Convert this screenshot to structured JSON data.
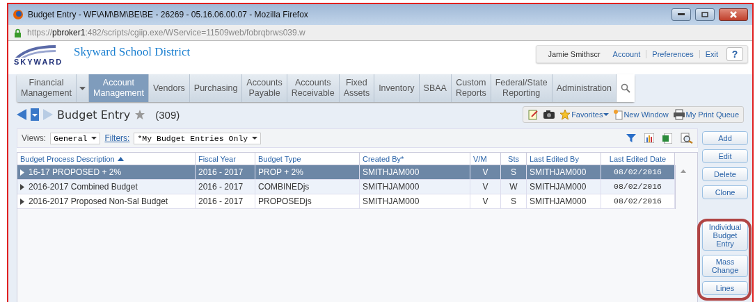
{
  "window": {
    "title": "Budget Entry - WF\\AM\\BM\\BE\\BE - 26269 - 05.16.06.00.07 - Mozilla Firefox",
    "url_prefix": "https://",
    "url_host": "pbroker1",
    "url_rest": ":482/scripts/cgiip.exe/WService=11509web/fobrqbrws039.w"
  },
  "header": {
    "logo_text": "SKYWARD",
    "district": "Skyward School District",
    "user": "Jamie Smithscr",
    "links": [
      "Account",
      "Preferences",
      "Exit"
    ],
    "help": "?"
  },
  "nav": [
    {
      "label": "Financial Management",
      "selected": false,
      "dropdown": true
    },
    {
      "label": "Account Management",
      "selected": true,
      "dropdown": false
    },
    {
      "label": "Vendors",
      "selected": false,
      "dropdown": false
    },
    {
      "label": "Purchasing",
      "selected": false,
      "dropdown": false
    },
    {
      "label": "Accounts Payable",
      "selected": false,
      "dropdown": false
    },
    {
      "label": "Accounts Receivable",
      "selected": false,
      "dropdown": false
    },
    {
      "label": "Fixed Assets",
      "selected": false,
      "dropdown": false
    },
    {
      "label": "Inventory",
      "selected": false,
      "dropdown": false
    },
    {
      "label": "SBAA",
      "selected": false,
      "dropdown": false
    },
    {
      "label": "Custom Reports",
      "selected": false,
      "dropdown": false
    },
    {
      "label": "Federal/State Reporting",
      "selected": false,
      "dropdown": false
    },
    {
      "label": "Administration",
      "selected": false,
      "dropdown": false
    }
  ],
  "page": {
    "title": "Budget Entry",
    "count": "(309)"
  },
  "tools": [
    {
      "kind": "notes"
    },
    {
      "kind": "camera"
    },
    {
      "kind": "star",
      "label": "Favorites"
    },
    {
      "kind": "window",
      "label": "New Window"
    },
    {
      "kind": "printer",
      "label": "My Print Queue"
    }
  ],
  "views": {
    "label": "Views:",
    "value": "General",
    "filters_label": "Filters:",
    "filter_value": "*My Budget Entries Only"
  },
  "table": {
    "columns": [
      {
        "label": "Budget Process Description",
        "sorted": true
      },
      {
        "label": "Fiscal Year",
        "sorted": false
      },
      {
        "label": "Budget Type",
        "sorted": false
      },
      {
        "label": "Created By*",
        "sorted": false
      },
      {
        "label": "V/M",
        "sorted": false
      },
      {
        "label": "Sts",
        "sorted": false
      },
      {
        "label": "Last Edited By",
        "sorted": false
      },
      {
        "label": "Last Edited Date",
        "sorted": false
      }
    ],
    "rows": [
      {
        "selected": true,
        "cells": [
          "16-17 PROPOSED + 2%",
          "2016 - 2017",
          "PROP + 2%",
          "SMITHJAM000",
          "V",
          "S",
          "SMITHJAM000",
          "08/02/2016"
        ]
      },
      {
        "selected": false,
        "cells": [
          "2016-2017 Combined Budget",
          "2016 - 2017",
          "COMBINEDjs",
          "SMITHJAM000",
          "V",
          "W",
          "SMITHJAM000",
          "08/02/2016"
        ]
      },
      {
        "selected": false,
        "cells": [
          "2016-2017 Proposed Non-Sal Budget",
          "2016 - 2017",
          "PROPOSEDjs",
          "SMITHJAM000",
          "V",
          "S",
          "SMITHJAM000",
          "08/02/2016"
        ]
      }
    ]
  },
  "actions": [
    "Add",
    "Edit",
    "Delete",
    "Clone",
    "Individual Budget Entry",
    "Mass Change",
    "Lines"
  ]
}
